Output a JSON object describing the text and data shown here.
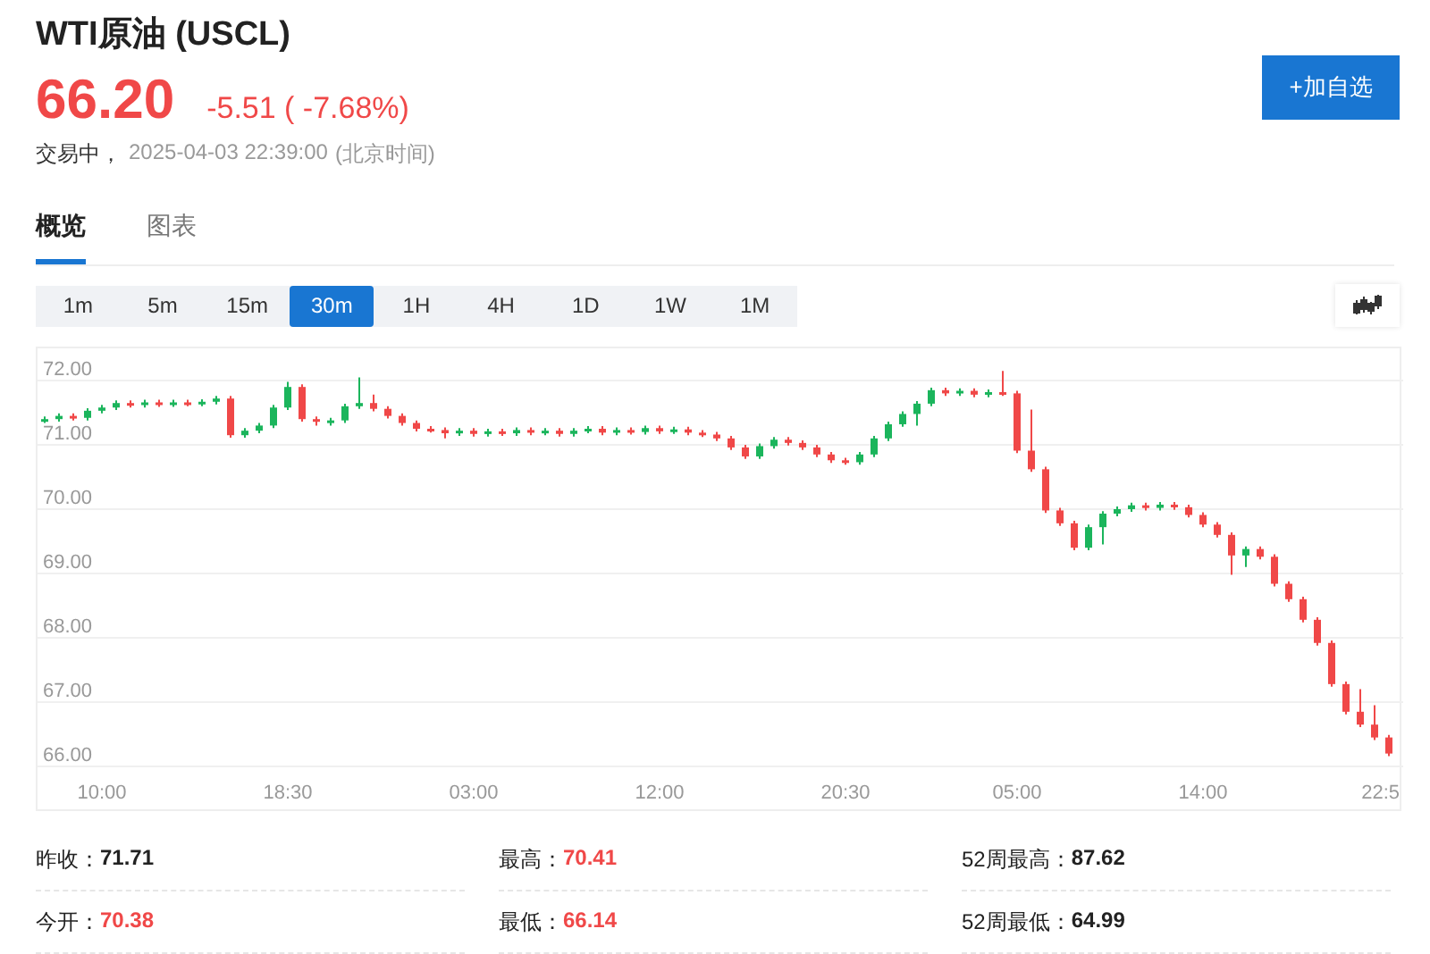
{
  "header": {
    "title": "WTI原油 (USCL)",
    "price": "66.20",
    "change": "-5.51 ( -7.68%)",
    "status": "交易中，",
    "time": "2025-04-03 22:39:00",
    "timezone": "(北京时间)",
    "watch_button": "+加自选"
  },
  "tabs": [
    {
      "label": "概览",
      "selected": true
    },
    {
      "label": "图表",
      "selected": false
    }
  ],
  "intervals": [
    {
      "label": "1m",
      "selected": false
    },
    {
      "label": "5m",
      "selected": false
    },
    {
      "label": "15m",
      "selected": false
    },
    {
      "label": "30m",
      "selected": true
    },
    {
      "label": "1H",
      "selected": false
    },
    {
      "label": "4H",
      "selected": false
    },
    {
      "label": "1D",
      "selected": false
    },
    {
      "label": "1W",
      "selected": false
    },
    {
      "label": "1M",
      "selected": false
    }
  ],
  "chart": {
    "chart_data": {
      "type": "candlestick",
      "ylim": [
        66,
        72.5
      ],
      "grid": true,
      "yticks": [
        {
          "value": 72,
          "label": "72.00"
        },
        {
          "value": 71,
          "label": "71.00"
        },
        {
          "value": 70,
          "label": "70.00"
        },
        {
          "value": 69,
          "label": "69.00"
        },
        {
          "value": 68,
          "label": "68.00"
        },
        {
          "value": 67,
          "label": "67.00"
        },
        {
          "value": 66,
          "label": "66.00"
        }
      ],
      "categories": [
        null,
        null,
        null,
        null,
        "10:00",
        null,
        null,
        null,
        null,
        null,
        null,
        null,
        null,
        null,
        null,
        null,
        null,
        "18:30",
        null,
        null,
        null,
        null,
        null,
        null,
        null,
        null,
        null,
        null,
        null,
        null,
        "03:00",
        null,
        null,
        null,
        null,
        null,
        null,
        null,
        null,
        null,
        null,
        null,
        null,
        "12:00",
        null,
        null,
        null,
        null,
        null,
        null,
        null,
        null,
        null,
        null,
        null,
        null,
        "20:30",
        null,
        null,
        null,
        null,
        null,
        null,
        null,
        null,
        null,
        null,
        null,
        "05:00",
        null,
        null,
        null,
        null,
        null,
        null,
        null,
        null,
        null,
        null,
        null,
        null,
        "14:00",
        null,
        null,
        null,
        null,
        null,
        null,
        null,
        null,
        null,
        null,
        null,
        null,
        "22:5"
      ],
      "ohlc": [
        [
          71.38,
          71.44,
          71.34,
          71.4
        ],
        [
          71.4,
          71.49,
          71.36,
          71.45
        ],
        [
          71.45,
          71.49,
          71.38,
          71.42
        ],
        [
          71.42,
          71.57,
          71.38,
          71.53
        ],
        [
          71.53,
          71.62,
          71.49,
          71.58
        ],
        [
          71.58,
          71.69,
          71.54,
          71.65
        ],
        [
          71.65,
          71.69,
          71.58,
          71.62
        ],
        [
          71.62,
          71.7,
          71.58,
          71.66
        ],
        [
          71.66,
          71.7,
          71.59,
          71.63
        ],
        [
          71.63,
          71.7,
          71.59,
          71.66
        ],
        [
          71.66,
          71.7,
          71.6,
          71.64
        ],
        [
          71.64,
          71.71,
          71.6,
          71.67
        ],
        [
          71.67,
          71.76,
          71.63,
          71.72
        ],
        [
          71.72,
          71.76,
          71.11,
          71.15
        ],
        [
          71.15,
          71.26,
          71.11,
          71.22
        ],
        [
          71.22,
          71.34,
          71.18,
          71.3
        ],
        [
          71.3,
          71.62,
          71.26,
          71.58
        ],
        [
          71.58,
          71.98,
          71.54,
          71.9
        ],
        [
          71.9,
          71.94,
          71.36,
          71.4
        ],
        [
          71.4,
          71.44,
          71.3,
          71.36
        ],
        [
          71.36,
          71.42,
          71.3,
          71.38
        ],
        [
          71.38,
          71.64,
          71.34,
          71.6
        ],
        [
          71.6,
          72.05,
          71.56,
          71.65
        ],
        [
          71.65,
          71.78,
          71.52,
          71.56
        ],
        [
          71.56,
          71.6,
          71.41,
          71.45
        ],
        [
          71.45,
          71.49,
          71.3,
          71.34
        ],
        [
          71.34,
          71.38,
          71.21,
          71.25
        ],
        [
          71.25,
          71.29,
          71.19,
          71.23
        ],
        [
          71.23,
          71.27,
          71.1,
          71.18
        ],
        [
          71.18,
          71.26,
          71.14,
          71.22
        ],
        [
          71.22,
          71.26,
          71.13,
          71.17
        ],
        [
          71.17,
          71.25,
          71.13,
          71.21
        ],
        [
          71.21,
          71.25,
          71.14,
          71.18
        ],
        [
          71.18,
          71.27,
          71.14,
          71.23
        ],
        [
          71.23,
          71.27,
          71.15,
          71.19
        ],
        [
          71.19,
          71.26,
          71.15,
          71.22
        ],
        [
          71.22,
          71.26,
          71.13,
          71.17
        ],
        [
          71.17,
          71.26,
          71.13,
          71.22
        ],
        [
          71.22,
          71.29,
          71.18,
          71.25
        ],
        [
          71.25,
          71.29,
          71.15,
          71.19
        ],
        [
          71.19,
          71.27,
          71.15,
          71.23
        ],
        [
          71.23,
          71.27,
          71.16,
          71.2
        ],
        [
          71.2,
          71.3,
          71.16,
          71.26
        ],
        [
          71.26,
          71.3,
          71.17,
          71.21
        ],
        [
          71.21,
          71.28,
          71.17,
          71.24
        ],
        [
          71.24,
          71.28,
          71.15,
          71.19
        ],
        [
          71.19,
          71.23,
          71.12,
          71.16
        ],
        [
          71.16,
          71.2,
          71.06,
          71.1
        ],
        [
          71.1,
          71.14,
          70.92,
          70.96
        ],
        [
          70.96,
          71.0,
          70.78,
          70.82
        ],
        [
          70.82,
          71.02,
          70.78,
          70.98
        ],
        [
          70.98,
          71.12,
          70.94,
          71.08
        ],
        [
          71.08,
          71.12,
          70.99,
          71.03
        ],
        [
          71.03,
          71.07,
          70.92,
          70.96
        ],
        [
          70.96,
          71.0,
          70.81,
          70.85
        ],
        [
          70.85,
          70.89,
          70.72,
          70.76
        ],
        [
          70.76,
          70.8,
          70.69,
          70.73
        ],
        [
          70.73,
          70.89,
          70.69,
          70.85
        ],
        [
          70.85,
          71.14,
          70.81,
          71.1
        ],
        [
          71.1,
          71.36,
          71.06,
          71.32
        ],
        [
          71.32,
          71.52,
          71.28,
          71.48
        ],
        [
          71.48,
          71.68,
          71.3,
          71.64
        ],
        [
          71.64,
          71.89,
          71.6,
          71.85
        ],
        [
          71.85,
          71.89,
          71.76,
          71.8
        ],
        [
          71.8,
          71.88,
          71.76,
          71.84
        ],
        [
          71.84,
          71.88,
          71.74,
          71.78
        ],
        [
          71.78,
          71.86,
          71.74,
          71.82
        ],
        [
          71.82,
          72.15,
          71.76,
          71.8
        ],
        [
          71.8,
          71.84,
          70.87,
          70.91
        ],
        [
          70.91,
          71.55,
          70.58,
          70.62
        ],
        [
          70.62,
          70.66,
          69.94,
          69.98
        ],
        [
          69.98,
          70.02,
          69.74,
          69.78
        ],
        [
          69.78,
          69.82,
          69.36,
          69.4
        ],
        [
          69.4,
          69.76,
          69.36,
          69.72
        ],
        [
          69.72,
          69.97,
          69.45,
          69.93
        ],
        [
          69.93,
          70.04,
          69.89,
          70.0
        ],
        [
          70.0,
          70.1,
          69.96,
          70.06
        ],
        [
          70.06,
          70.1,
          69.98,
          70.02
        ],
        [
          70.02,
          70.11,
          69.98,
          70.07
        ],
        [
          70.07,
          70.11,
          69.99,
          70.03
        ],
        [
          70.03,
          70.07,
          69.87,
          69.91
        ],
        [
          69.91,
          69.95,
          69.72,
          69.76
        ],
        [
          69.76,
          69.8,
          69.56,
          69.6
        ],
        [
          69.6,
          69.64,
          68.98,
          69.28
        ],
        [
          69.28,
          69.42,
          69.1,
          69.38
        ],
        [
          69.38,
          69.42,
          69.22,
          69.26
        ],
        [
          69.26,
          69.3,
          68.8,
          68.84
        ],
        [
          68.84,
          68.88,
          68.56,
          68.6
        ],
        [
          68.6,
          68.64,
          68.24,
          68.28
        ],
        [
          68.28,
          68.32,
          67.88,
          67.92
        ],
        [
          67.92,
          67.96,
          67.24,
          67.28
        ],
        [
          67.28,
          67.32,
          66.81,
          66.85
        ],
        [
          66.85,
          67.2,
          66.61,
          66.65
        ],
        [
          66.65,
          66.95,
          66.41,
          66.45
        ],
        [
          66.45,
          66.49,
          66.16,
          66.2
        ]
      ]
    }
  },
  "stats": [
    {
      "label": "昨收：",
      "value": "71.71",
      "color": "#222222"
    },
    {
      "label": "最高：",
      "value": "70.41",
      "color": "#f04848"
    },
    {
      "label": "52周最高：",
      "value": "87.62",
      "color": "#222222"
    },
    {
      "label": "今开：",
      "value": "70.38",
      "color": "#f04848"
    },
    {
      "label": "最低：",
      "value": "66.14",
      "color": "#f04848"
    },
    {
      "label": "52周最低：",
      "value": "64.99",
      "color": "#222222"
    }
  ]
}
